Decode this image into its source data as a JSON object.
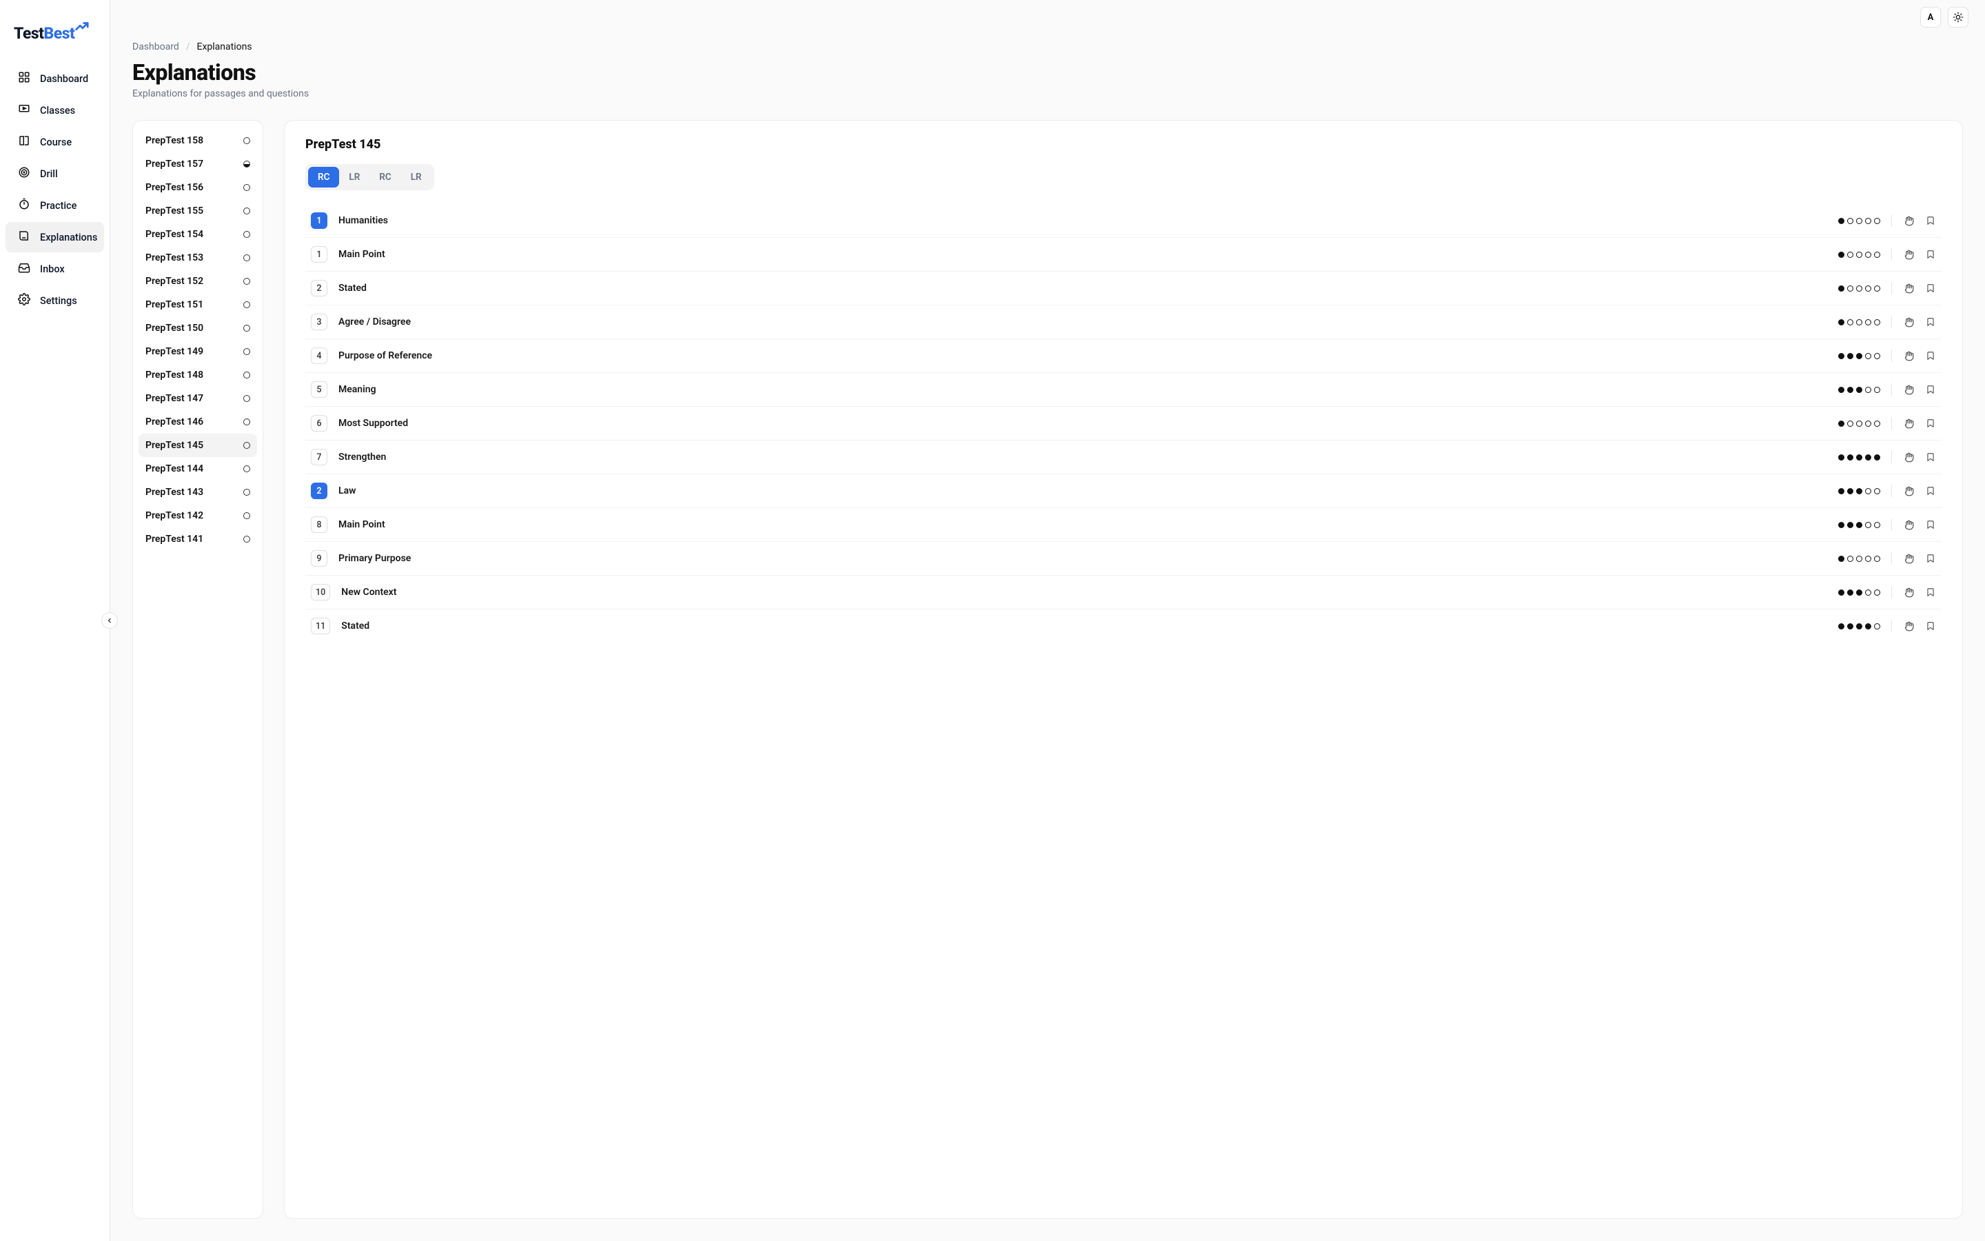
{
  "brand": {
    "left": "Test",
    "right": "Best"
  },
  "topbar": {
    "avatar_letter": "A"
  },
  "sidebar": {
    "items": [
      {
        "label": "Dashboard",
        "icon": "dashboard",
        "active": false
      },
      {
        "label": "Classes",
        "icon": "classes",
        "active": false
      },
      {
        "label": "Course",
        "icon": "course",
        "active": false
      },
      {
        "label": "Drill",
        "icon": "drill",
        "active": false
      },
      {
        "label": "Practice",
        "icon": "practice",
        "active": false
      },
      {
        "label": "Explanations",
        "icon": "explanations",
        "active": true
      },
      {
        "label": "Inbox",
        "icon": "inbox",
        "active": false
      },
      {
        "label": "Settings",
        "icon": "settings",
        "active": false
      }
    ]
  },
  "breadcrumb": {
    "root": "Dashboard",
    "current": "Explanations"
  },
  "page": {
    "title": "Explanations",
    "subtitle": "Explanations for passages and questions"
  },
  "test_list": {
    "items": [
      {
        "label": "PrepTest 158",
        "status": "empty",
        "active": false
      },
      {
        "label": "PrepTest 157",
        "status": "half",
        "active": false
      },
      {
        "label": "PrepTest 156",
        "status": "empty",
        "active": false
      },
      {
        "label": "PrepTest 155",
        "status": "empty",
        "active": false
      },
      {
        "label": "PrepTest 154",
        "status": "empty",
        "active": false
      },
      {
        "label": "PrepTest 153",
        "status": "empty",
        "active": false
      },
      {
        "label": "PrepTest 152",
        "status": "empty",
        "active": false
      },
      {
        "label": "PrepTest 151",
        "status": "empty",
        "active": false
      },
      {
        "label": "PrepTest 150",
        "status": "empty",
        "active": false
      },
      {
        "label": "PrepTest 149",
        "status": "empty",
        "active": false
      },
      {
        "label": "PrepTest 148",
        "status": "empty",
        "active": false
      },
      {
        "label": "PrepTest 147",
        "status": "empty",
        "active": false
      },
      {
        "label": "PrepTest 146",
        "status": "empty",
        "active": false
      },
      {
        "label": "PrepTest 145",
        "status": "empty",
        "active": true
      },
      {
        "label": "PrepTest 144",
        "status": "empty",
        "active": false
      },
      {
        "label": "PrepTest 143",
        "status": "empty",
        "active": false
      },
      {
        "label": "PrepTest 142",
        "status": "empty",
        "active": false
      },
      {
        "label": "PrepTest 141",
        "status": "empty",
        "active": false
      }
    ]
  },
  "detail": {
    "title": "PrepTest 145",
    "tabs": [
      {
        "label": "RC",
        "active": true
      },
      {
        "label": "LR",
        "active": false
      },
      {
        "label": "RC",
        "active": false
      },
      {
        "label": "LR",
        "active": false
      }
    ],
    "rows": [
      {
        "num": "1",
        "passage": true,
        "title": "Humanities",
        "difficulty": 1
      },
      {
        "num": "1",
        "passage": false,
        "title": "Main Point",
        "difficulty": 1
      },
      {
        "num": "2",
        "passage": false,
        "title": "Stated",
        "difficulty": 1
      },
      {
        "num": "3",
        "passage": false,
        "title": "Agree / Disagree",
        "difficulty": 1
      },
      {
        "num": "4",
        "passage": false,
        "title": "Purpose of Reference",
        "difficulty": 3
      },
      {
        "num": "5",
        "passage": false,
        "title": "Meaning",
        "difficulty": 3
      },
      {
        "num": "6",
        "passage": false,
        "title": "Most Supported",
        "difficulty": 1
      },
      {
        "num": "7",
        "passage": false,
        "title": "Strengthen",
        "difficulty": 5
      },
      {
        "num": "2",
        "passage": true,
        "title": "Law",
        "difficulty": 3
      },
      {
        "num": "8",
        "passage": false,
        "title": "Main Point",
        "difficulty": 3
      },
      {
        "num": "9",
        "passage": false,
        "title": "Primary Purpose",
        "difficulty": 1
      },
      {
        "num": "10",
        "passage": false,
        "title": "New Context",
        "difficulty": 3
      },
      {
        "num": "11",
        "passage": false,
        "title": "Stated",
        "difficulty": 4
      }
    ]
  }
}
